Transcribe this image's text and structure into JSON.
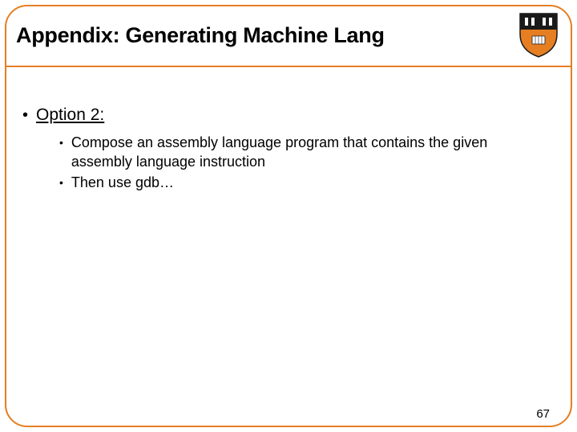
{
  "slide": {
    "title": "Appendix: Generating Machine Lang",
    "page_number": "67"
  },
  "logo": {
    "name": "princeton-shield",
    "colors": {
      "primary": "#e67e22",
      "dark": "#1a1a1a",
      "white": "#ffffff"
    }
  },
  "bullets": {
    "level1": "Option 2:",
    "level2": [
      "Compose an assembly language program that contains the given assembly language instruction",
      "Then use gdb…"
    ]
  }
}
